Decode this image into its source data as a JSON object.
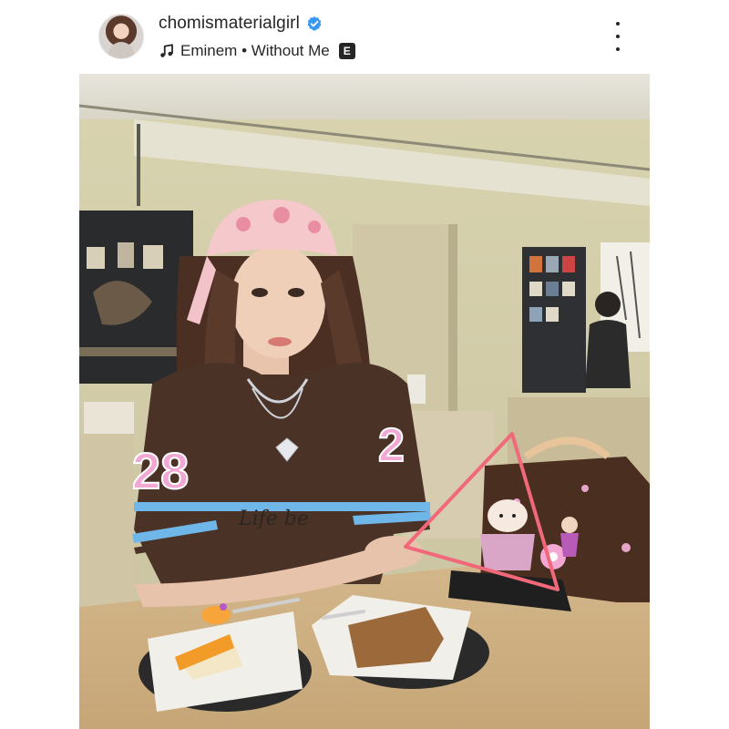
{
  "post": {
    "username": "chomismaterialgirl",
    "verified_icon": "verified-badge-icon",
    "music": {
      "icon": "music-note-icon",
      "track": "Eminem • Without Me",
      "explicit_label": "E"
    },
    "more_icon": "more-vertical-icon"
  },
  "photo": {
    "jersey_left_number": "28",
    "jersey_right_number": "2",
    "jersey_script": "Life be"
  },
  "colors": {
    "verified": "#3897f0",
    "text": "#262626",
    "annotation_triangle": "#f0687a"
  }
}
